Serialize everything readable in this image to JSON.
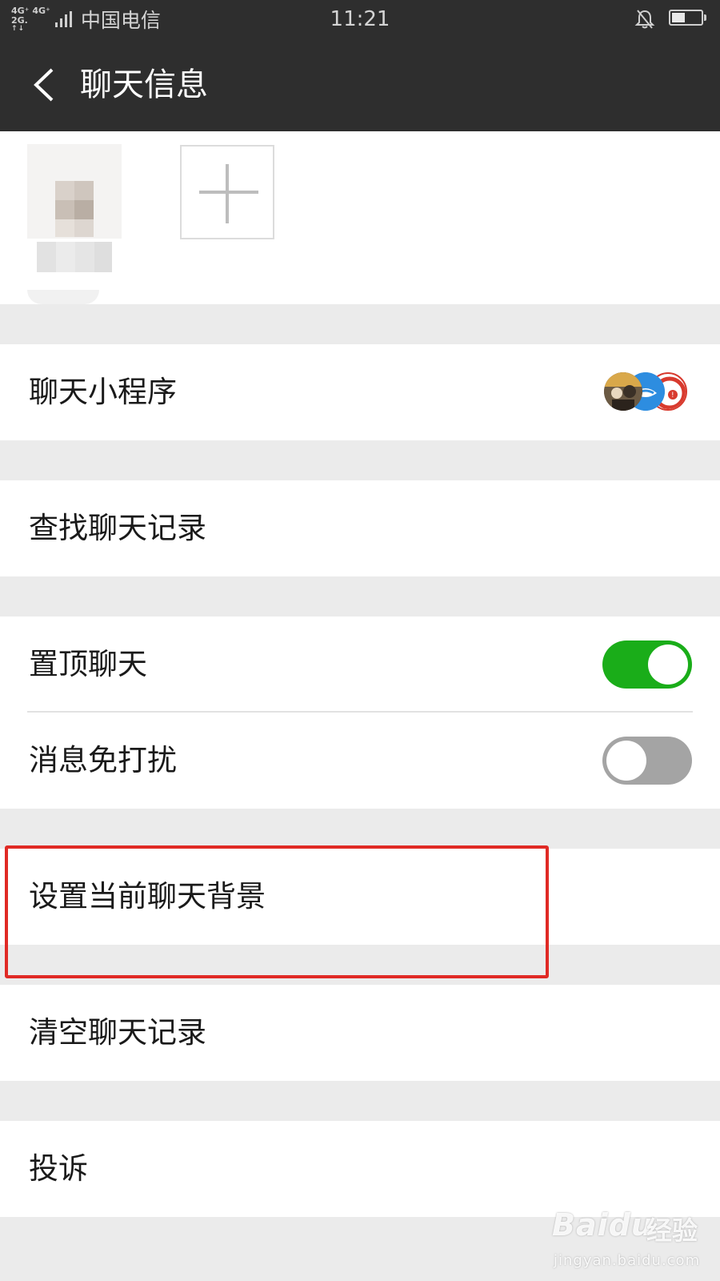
{
  "status_bar": {
    "network_top": "4G⁺ 4G⁺",
    "network_bottom": "2G.",
    "network_arrows": "↑↓",
    "carrier": "中国电信",
    "time": "11:21",
    "battery_level": 0.45,
    "icons": [
      "signal-icon",
      "bell-mute-icon",
      "battery-icon"
    ]
  },
  "header": {
    "back_icon": "chevron-left-icon",
    "title": "聊天信息"
  },
  "members": {
    "add_icon": "plus-icon"
  },
  "rows": {
    "mini_programs": "聊天小程序",
    "search_history": "查找聊天记录",
    "pin_chat": "置顶聊天",
    "mute": "消息免打扰",
    "set_background": "设置当前聊天背景",
    "clear_history": "清空聊天记录",
    "complain": "投诉"
  },
  "toggles": {
    "pin_chat": true,
    "mute": false
  },
  "colors": {
    "header_bg": "#2e2e2e",
    "toggle_on": "#1aad19",
    "toggle_off": "#a4a4a4",
    "highlight": "#e02a25",
    "page_bg": "#ebebeb"
  },
  "watermark": {
    "logo": "Baidu",
    "brand": "经验",
    "url": "jingyan.baidu.com"
  }
}
